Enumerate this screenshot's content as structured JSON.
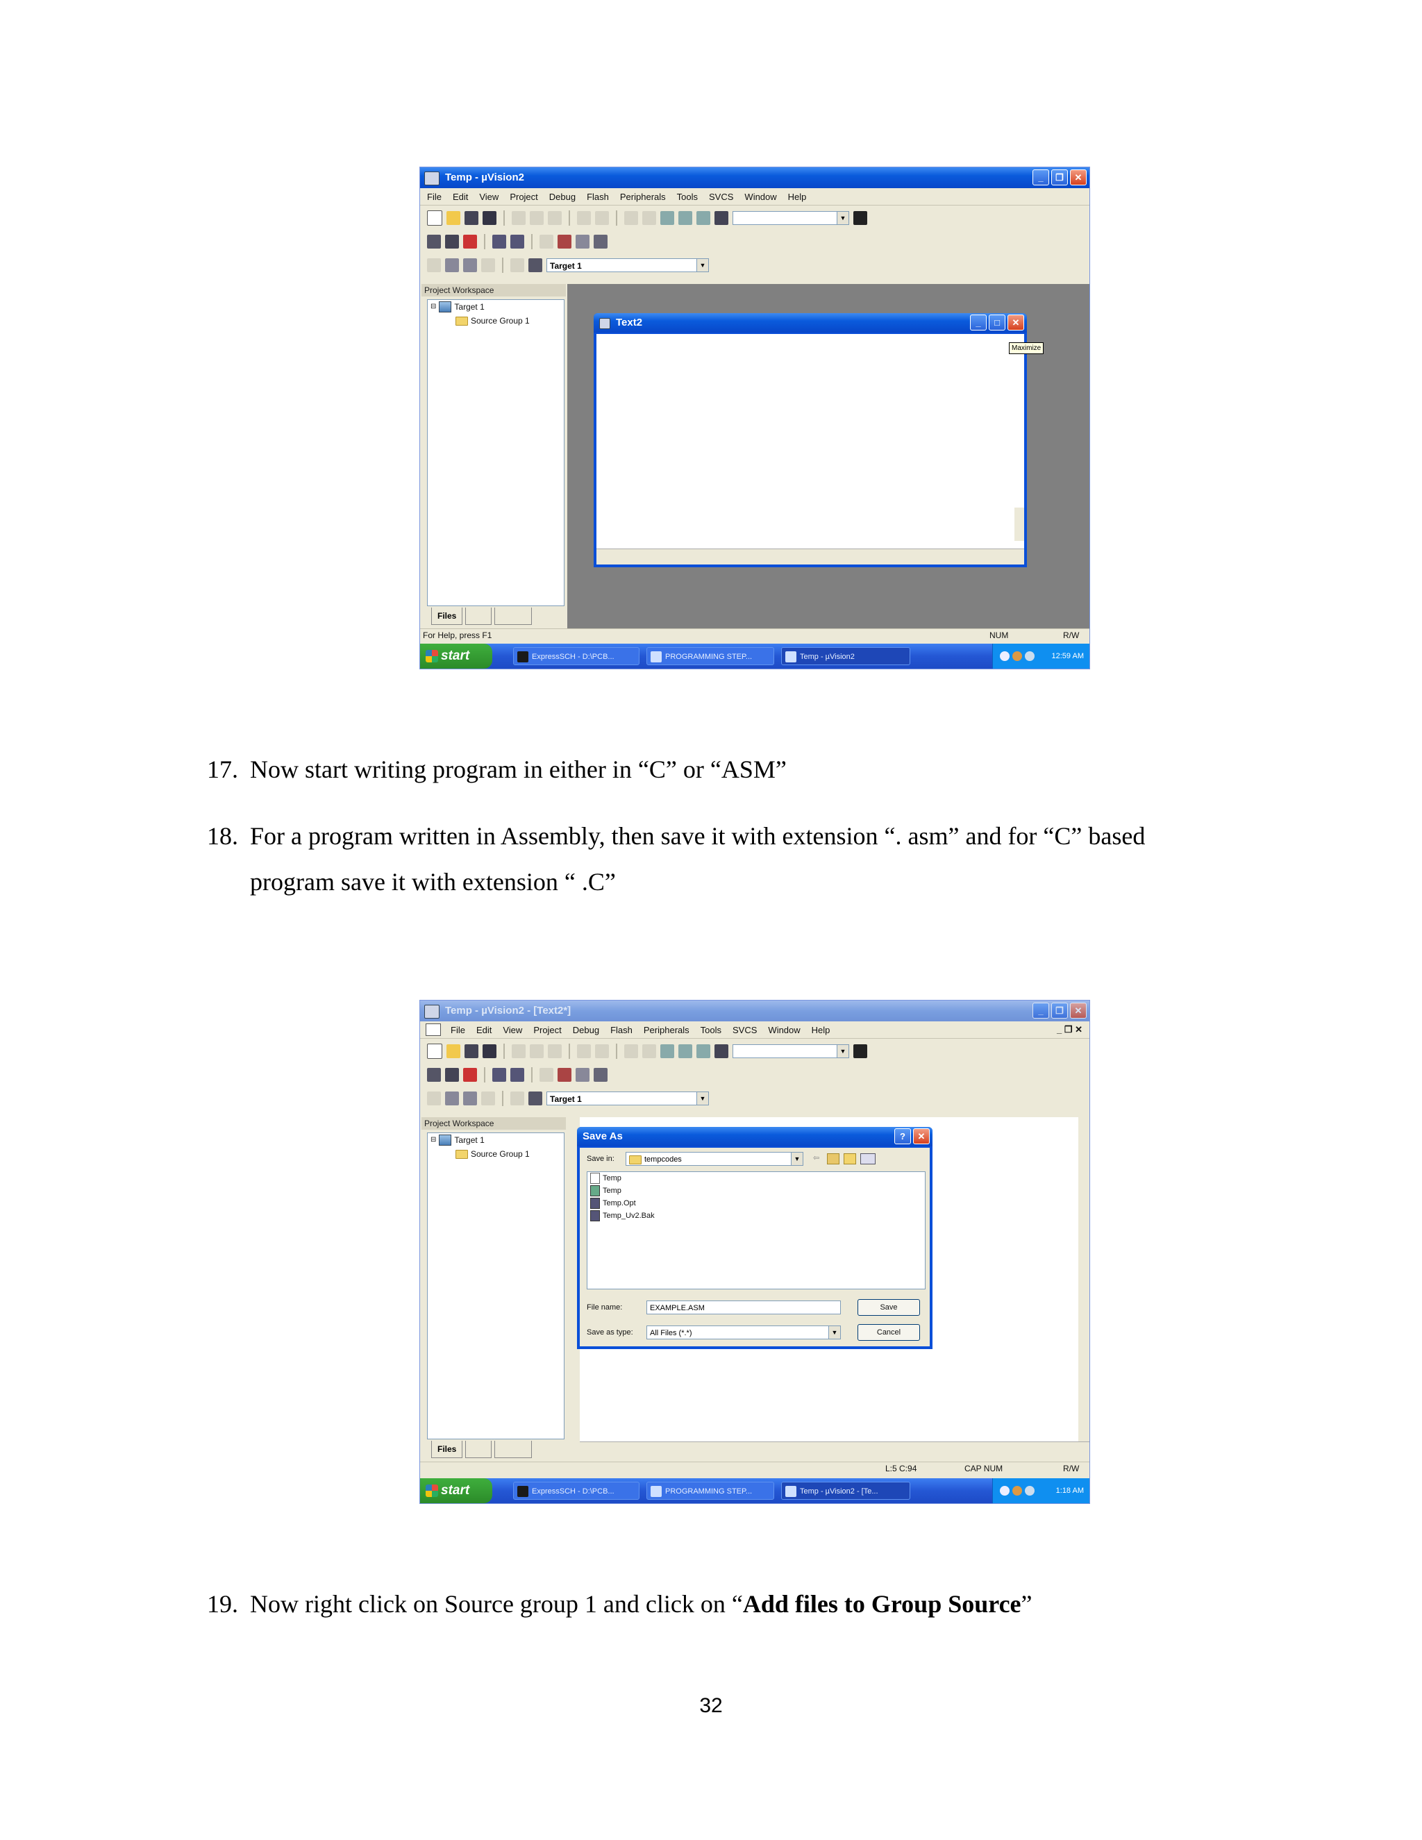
{
  "screenshot1": {
    "title": "Temp - µVision2",
    "menu": [
      "File",
      "Edit",
      "View",
      "Project",
      "Debug",
      "Flash",
      "Peripherals",
      "Tools",
      "SVCS",
      "Window",
      "Help"
    ],
    "target_combo": "Target 1",
    "workspace_title": "Project Workspace",
    "tree": [
      "Target 1",
      "Source Group 1"
    ],
    "tabs": [
      "Files",
      "",
      ""
    ],
    "editor_title": "Text2",
    "tooltip": "Maximize",
    "status_help": "For Help, press F1",
    "status_num": "NUM",
    "status_rw": "R/W",
    "taskbar": {
      "start": "start",
      "items": [
        "ExpressSCH - D:\\PCB...",
        "PROGRAMMING STEP...",
        "Temp - µVision2"
      ],
      "clock": "12:59 AM"
    }
  },
  "steps_a": [
    {
      "num": "17.",
      "text": "Now start writing program in either in “C” or “ASM”"
    },
    {
      "num": "18.",
      "line1": "For a program written in Assembly, then save it with extension “. asm” and for “C” based",
      "line2": "program save it with extension “ .C”"
    }
  ],
  "screenshot2": {
    "title": "Temp - µVision2 - [Text2*]",
    "menu": [
      "File",
      "Edit",
      "View",
      "Project",
      "Debug",
      "Flash",
      "Peripherals",
      "Tools",
      "SVCS",
      "Window",
      "Help"
    ],
    "target_combo": "Target 1",
    "workspace_title": "Project Workspace",
    "tree": [
      "Target 1",
      "Source Group 1"
    ],
    "tabs": [
      "Files",
      "",
      ""
    ],
    "dialog": {
      "title": "Save As",
      "save_in_label": "Save in:",
      "save_in_value": "tempcodes",
      "files": [
        "Temp",
        "Temp",
        "Temp.Opt",
        "Temp_Uv2.Bak"
      ],
      "filename_label": "File name:",
      "filename_value": "EXAMPLE.ASM",
      "type_label": "Save as type:",
      "type_value": "All Files (*.*)",
      "save_button": "Save",
      "cancel_button": "Cancel"
    },
    "status_pos": "L:5 C:94",
    "status_cap": "CAP NUM",
    "status_rw": "R/W",
    "taskbar": {
      "start": "start",
      "items": [
        "ExpressSCH - D:\\PCB...",
        "PROGRAMMING STEP...",
        "Temp - µVision2 - [Te..."
      ],
      "clock": "1:18 AM"
    }
  },
  "step_c": {
    "num": "19.",
    "pre": "Now right click on Source group 1 and click on “",
    "bold": "Add files to Group Source",
    "post": "”"
  },
  "page_number": "32"
}
